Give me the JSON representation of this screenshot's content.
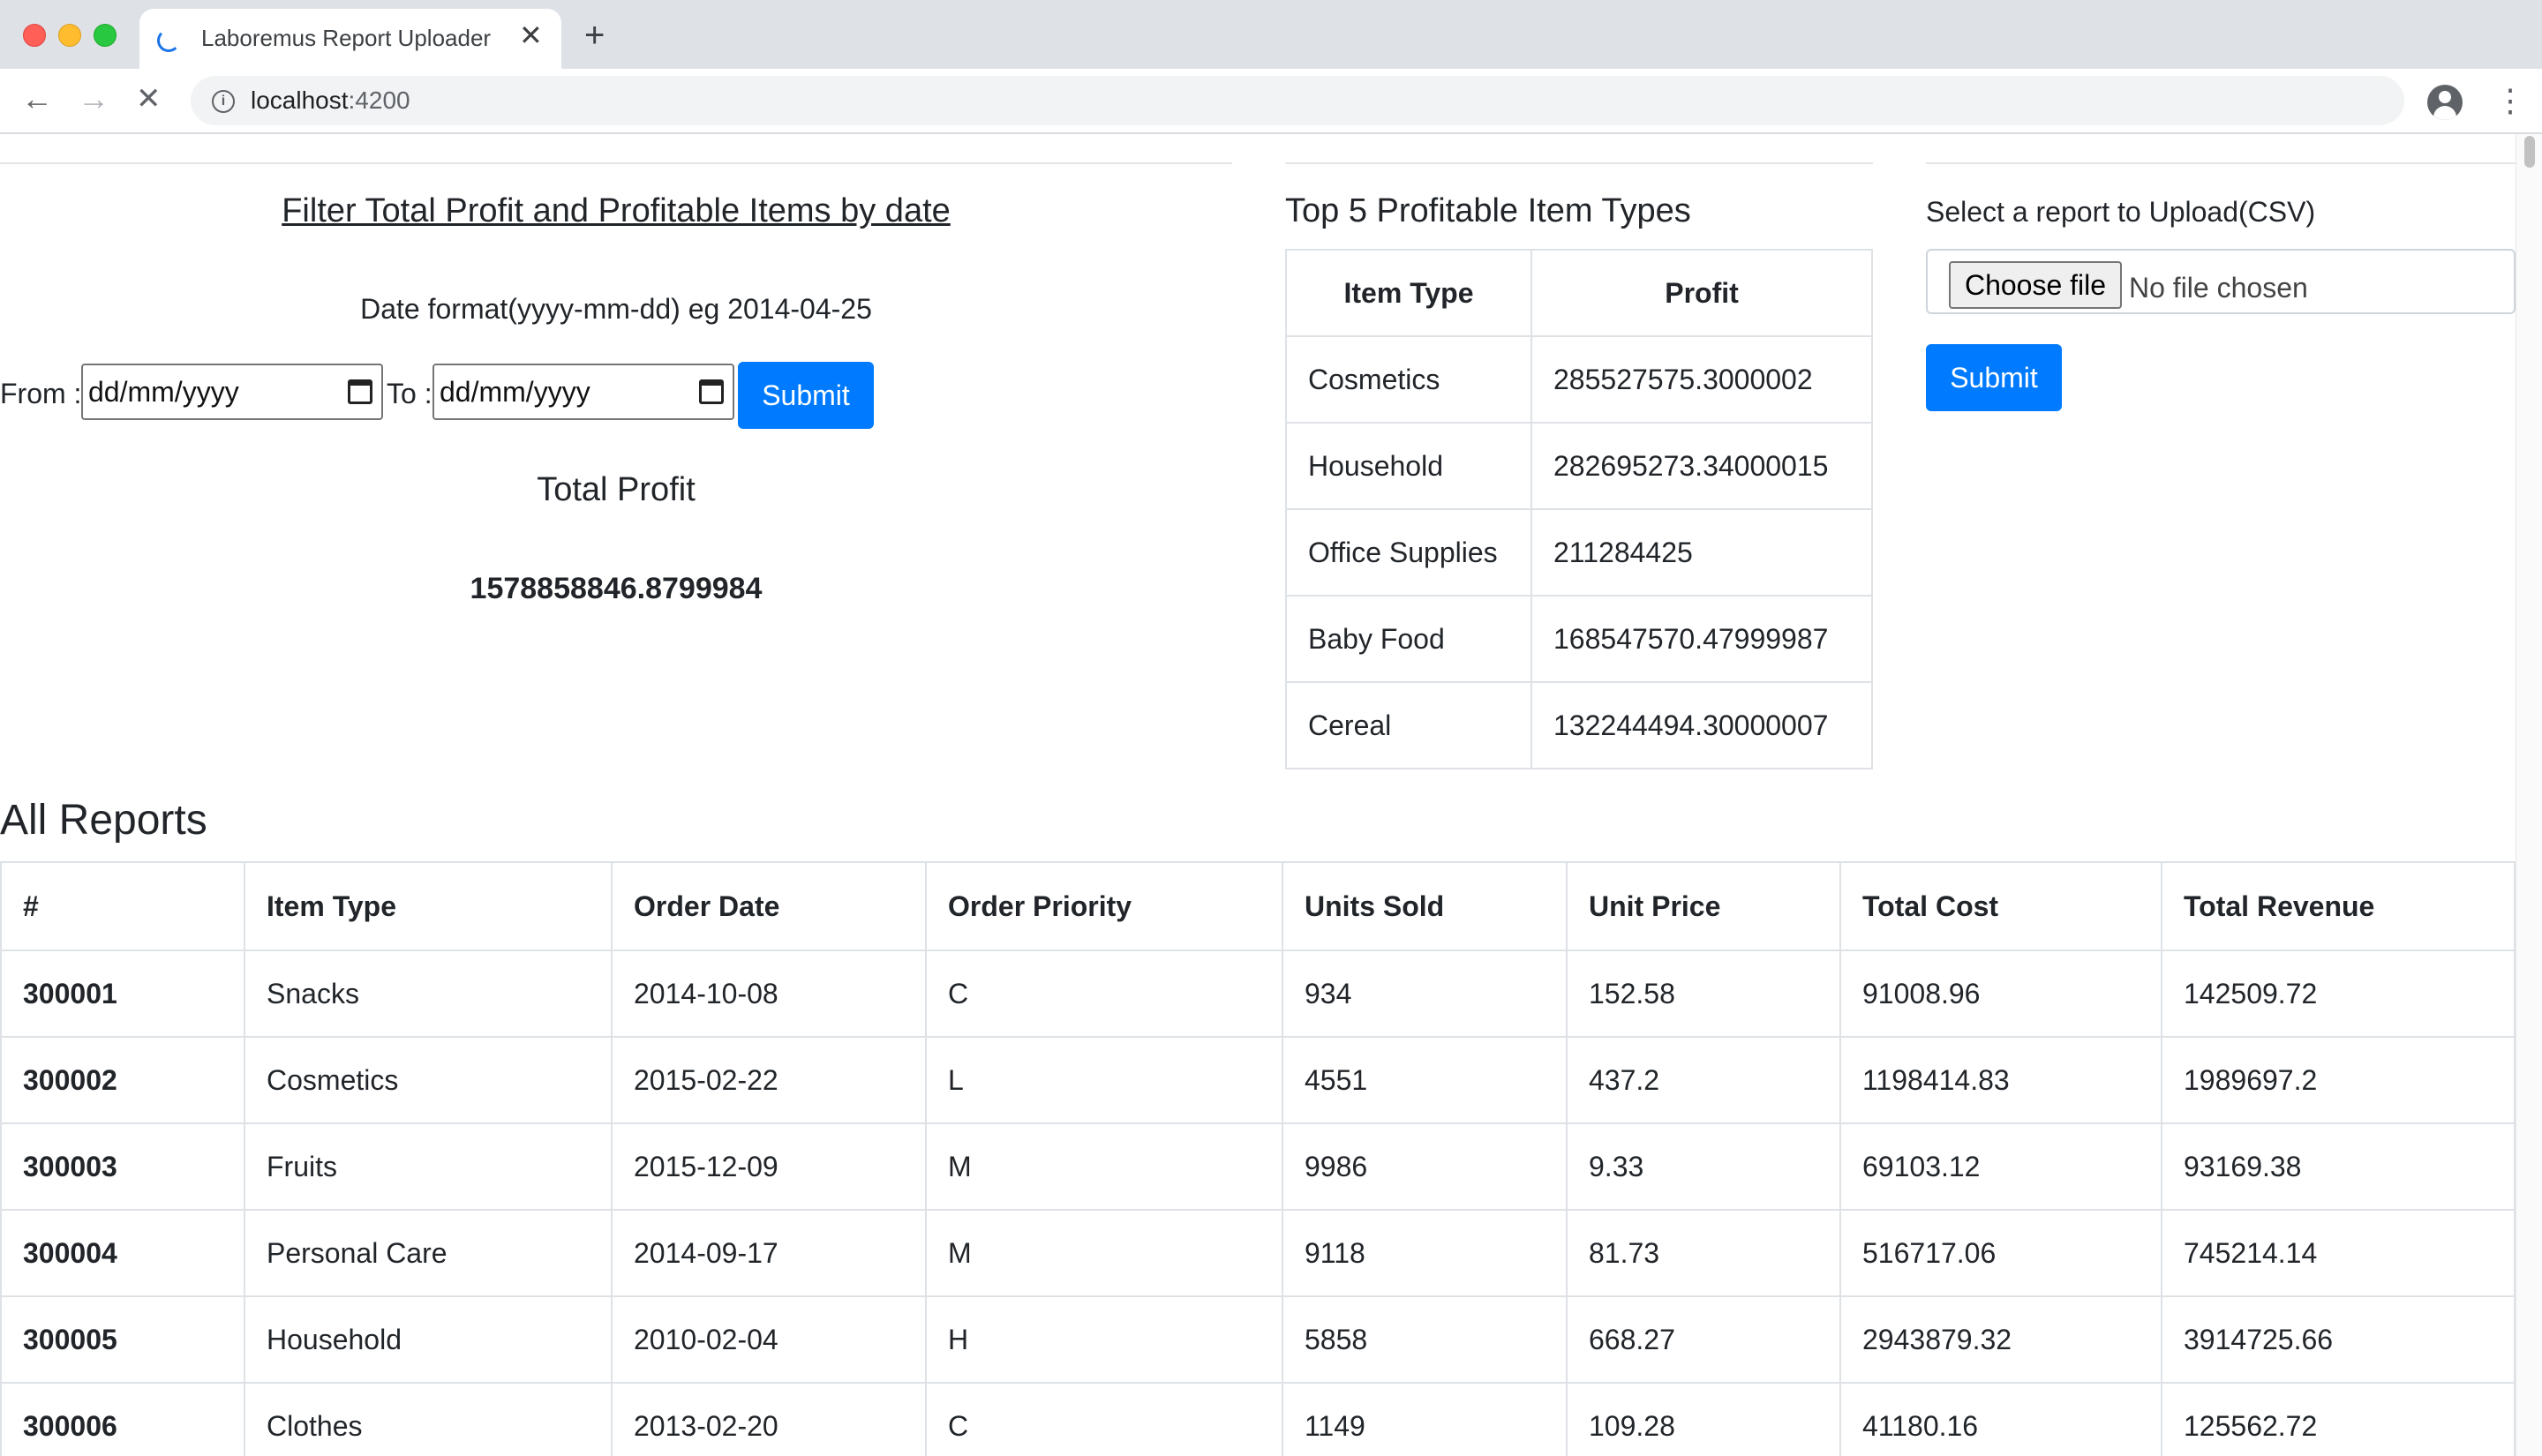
{
  "browser": {
    "tab_title": "Laboremus Report Uploader",
    "url_host": "localhost",
    "url_port": ":4200",
    "close_glyph": "✕",
    "new_tab_glyph": "+"
  },
  "filter": {
    "title": "Filter Total Profit and Profitable Items by date",
    "hint": "Date format(yyyy-mm-dd) eg 2014-04-25",
    "from_label": "From :",
    "to_label": "To :",
    "from_placeholder": "dd/mm/yyyy",
    "to_placeholder": "dd/mm/yyyy",
    "submit_label": "Submit",
    "total_label": "Total Profit",
    "total_value": "1578858846.8799984"
  },
  "top5": {
    "title": "Top 5 Profitable Item Types",
    "headers": [
      "Item Type",
      "Profit"
    ],
    "rows": [
      [
        "Cosmetics",
        "285527575.3000002"
      ],
      [
        "Household",
        "282695273.34000015"
      ],
      [
        "Office Supplies",
        "211284425"
      ],
      [
        "Baby Food",
        "168547570.47999987"
      ],
      [
        "Cereal",
        "132244494.30000007"
      ]
    ]
  },
  "upload": {
    "label": "Select a report to Upload(CSV)",
    "choose_label": "Choose file",
    "no_file_label": "No file chosen",
    "submit_label": "Submit"
  },
  "reports": {
    "title": "All Reports",
    "headers": [
      "#",
      "Item Type",
      "Order Date",
      "Order Priority",
      "Units Sold",
      "Unit Price",
      "Total Cost",
      "Total Revenue"
    ],
    "rows": [
      [
        "300001",
        "Snacks",
        "2014-10-08",
        "C",
        "934",
        "152.58",
        "91008.96",
        "142509.72"
      ],
      [
        "300002",
        "Cosmetics",
        "2015-02-22",
        "L",
        "4551",
        "437.2",
        "1198414.83",
        "1989697.2"
      ],
      [
        "300003",
        "Fruits",
        "2015-12-09",
        "M",
        "9986",
        "9.33",
        "69103.12",
        "93169.38"
      ],
      [
        "300004",
        "Personal Care",
        "2014-09-17",
        "M",
        "9118",
        "81.73",
        "516717.06",
        "745214.14"
      ],
      [
        "300005",
        "Household",
        "2010-02-04",
        "H",
        "5858",
        "668.27",
        "2943879.32",
        "3914725.66"
      ],
      [
        "300006",
        "Clothes",
        "2013-02-20",
        "C",
        "1149",
        "109.28",
        "41180.16",
        "125562.72"
      ]
    ]
  }
}
